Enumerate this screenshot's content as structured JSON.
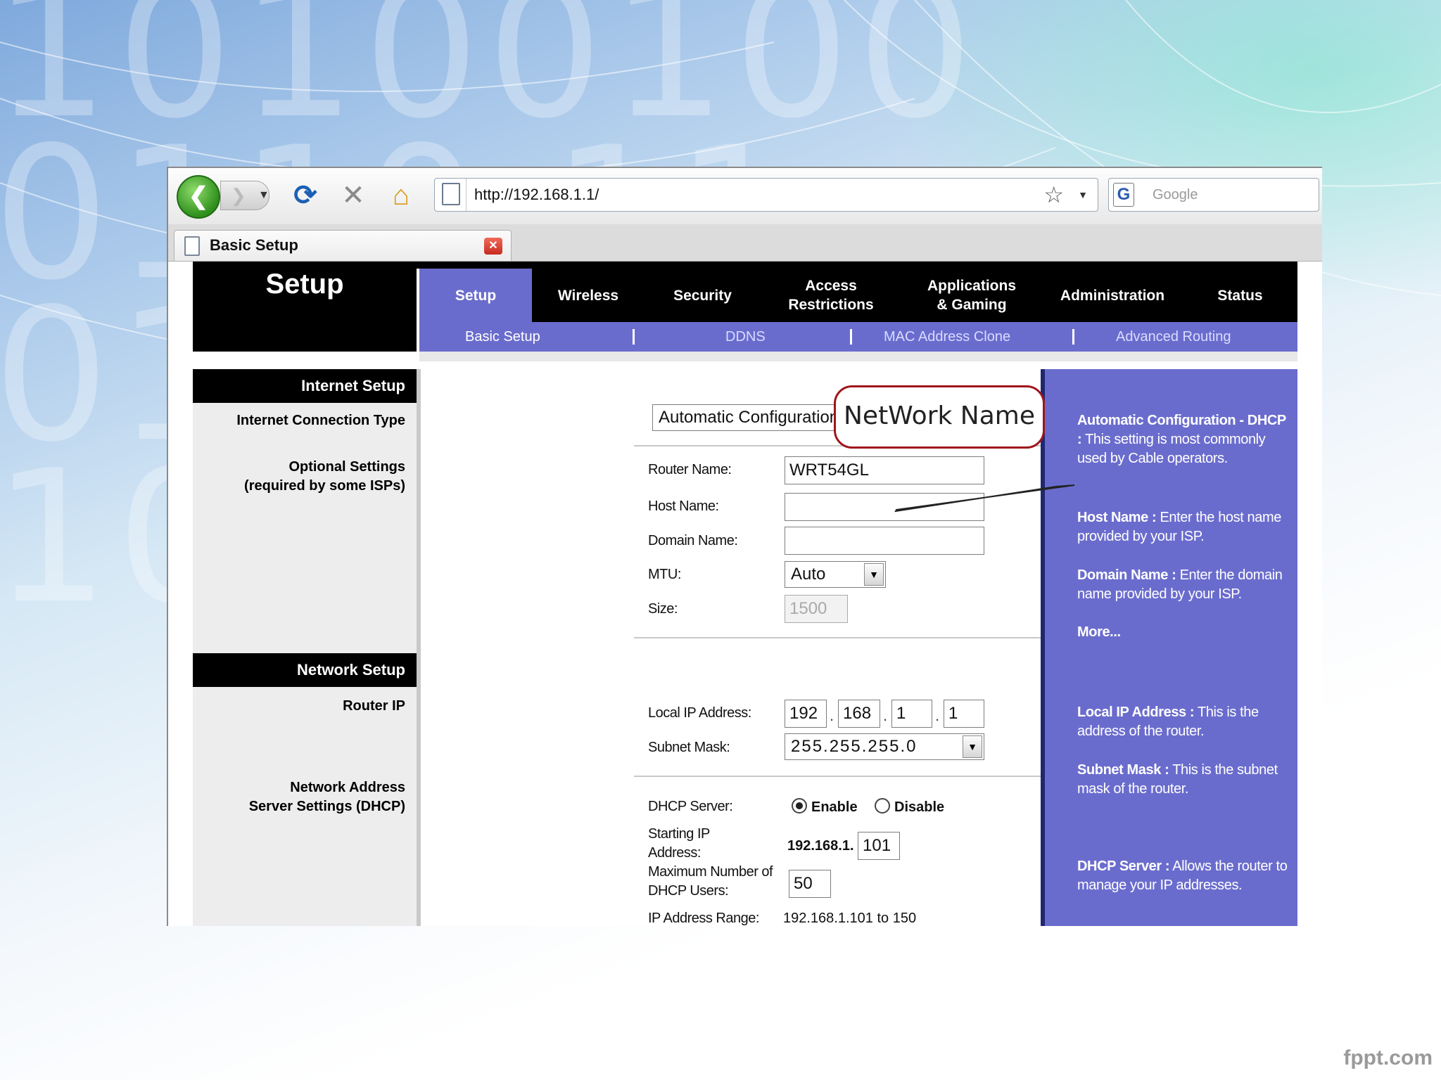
{
  "browser": {
    "url": "http://192.168.1.1/",
    "search_placeholder": "Google",
    "tab_title": "Basic Setup",
    "icons": [
      "back-icon",
      "forward-icon",
      "reload-icon",
      "stop-icon",
      "home-icon",
      "page-icon",
      "bookmark-star-icon",
      "google-icon",
      "tab-close-icon"
    ]
  },
  "router": {
    "logo_title": "Setup",
    "nav": [
      {
        "label": "Setup",
        "active": true
      },
      {
        "label": "Wireless"
      },
      {
        "label": "Security"
      },
      {
        "label": "Access\nRestrictions"
      },
      {
        "label": "Applications\n& Gaming"
      },
      {
        "label": "Administration"
      },
      {
        "label": "Status"
      }
    ],
    "subnav": [
      "Basic Setup",
      "DDNS",
      "MAC Address Clone",
      "Advanced Routing"
    ],
    "sections": {
      "internet_setup": "Internet Setup",
      "internet_connection_type": "Internet Connection Type",
      "optional_settings_1": "Optional Settings",
      "optional_settings_2": "(required by some ISPs)",
      "network_setup": "Network Setup",
      "router_ip": "Router IP",
      "dhcp_1": "Network Address",
      "dhcp_2": "Server Settings (DHCP)"
    },
    "form": {
      "connection_type": "Automatic Configuration - DHCP",
      "router_name_label": "Router Name:",
      "router_name": "WRT54GL",
      "host_name_label": "Host Name:",
      "host_name": "",
      "domain_name_label": "Domain Name:",
      "domain_name": "",
      "mtu_label": "MTU:",
      "mtu": "Auto",
      "size_label": "Size:",
      "size": "1500",
      "local_ip_label": "Local IP Address:",
      "ip": [
        "192",
        "168",
        "1",
        "1"
      ],
      "subnet_label": "Subnet Mask:",
      "subnet": "255.255.255.0",
      "dhcp_label": "DHCP Server:",
      "dhcp_enable": "Enable",
      "dhcp_disable": "Disable",
      "start_ip_label_1": "Starting IP",
      "start_ip_label_2": "Address:",
      "start_ip_prefix": "192.168.1.",
      "start_ip": "101",
      "max_users_label_1": "Maximum Number of",
      "max_users_label_2": "DHCP Users:",
      "max_users": "50",
      "range_label": "IP Address Range:",
      "range": "192.168.1.101 to 150"
    },
    "help": {
      "auto_title": "Automatic Configuration - DHCP :",
      "auto_text": "This setting is most commonly used by Cable operators.",
      "host_title": "Host Name :",
      "host_text": "Enter the host name provided by your ISP.",
      "domain_title": "Domain Name :",
      "domain_text": "Enter the domain name provided by your ISP.",
      "more": "More...",
      "localip_title": "Local IP Address :",
      "localip_text": "This is the address of the router.",
      "subnet_title": "Subnet Mask :",
      "subnet_text": "This is the subnet mask of the router.",
      "dhcp_title": "DHCP Server :",
      "dhcp_text": "Allows the router to manage your IP addresses."
    }
  },
  "callout": "NetWork Name",
  "watermark": "fppt.com",
  "background_digits": "10100100\n0110 11\n01\n10",
  "colors": {
    "router_accent": "#6a6ccd",
    "callout_border": "#a0151c"
  }
}
